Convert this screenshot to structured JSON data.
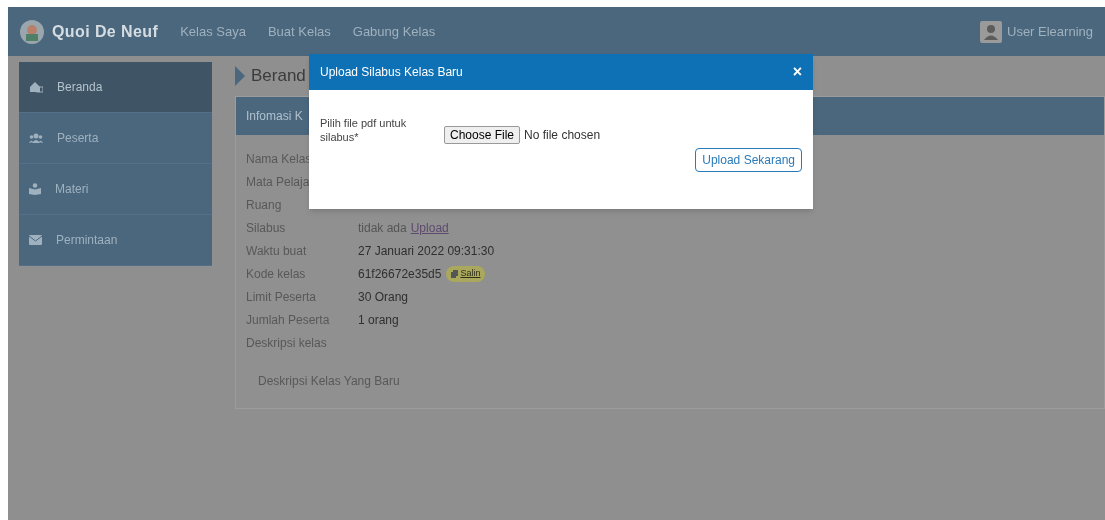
{
  "navbar": {
    "brand": "Quoi De Neuf",
    "links": [
      "Kelas Saya",
      "Buat Kelas",
      "Gabung Kelas"
    ],
    "user": "User Elearning"
  },
  "sidebar": {
    "items": [
      {
        "label": "Beranda",
        "selected": true
      },
      {
        "label": "Peserta",
        "selected": false
      },
      {
        "label": "Materi",
        "selected": false
      },
      {
        "label": "Permintaan",
        "selected": false
      }
    ]
  },
  "page_title": "Berand",
  "info_card": {
    "title": "Infomasi K",
    "rows": [
      {
        "label": "Nama Kelas"
      },
      {
        "label": "Mata Pelaja"
      },
      {
        "label": "Ruang"
      },
      {
        "label": "Silabus",
        "value": "tidak ada",
        "link": "Upload"
      },
      {
        "label": "Waktu buat",
        "value": "27 Januari 2022 09:31:30"
      },
      {
        "label": "Kode kelas",
        "value": "61f26672e35d5",
        "badge": "Salin"
      },
      {
        "label": "Limit Peserta",
        "value": "30 Orang"
      },
      {
        "label": "Jumlah Peserta",
        "value": "1 orang"
      },
      {
        "label": "Deskripsi kelas"
      }
    ],
    "description": "Deskripsi Kelas Yang Baru"
  },
  "modal": {
    "title": "Upload Silabus Kelas Baru",
    "close": "×",
    "field_label": "Pilih file pdf untuk silabus*",
    "file_button": "Choose File",
    "file_status": "No file chosen",
    "submit": "Upload Sekarang"
  }
}
